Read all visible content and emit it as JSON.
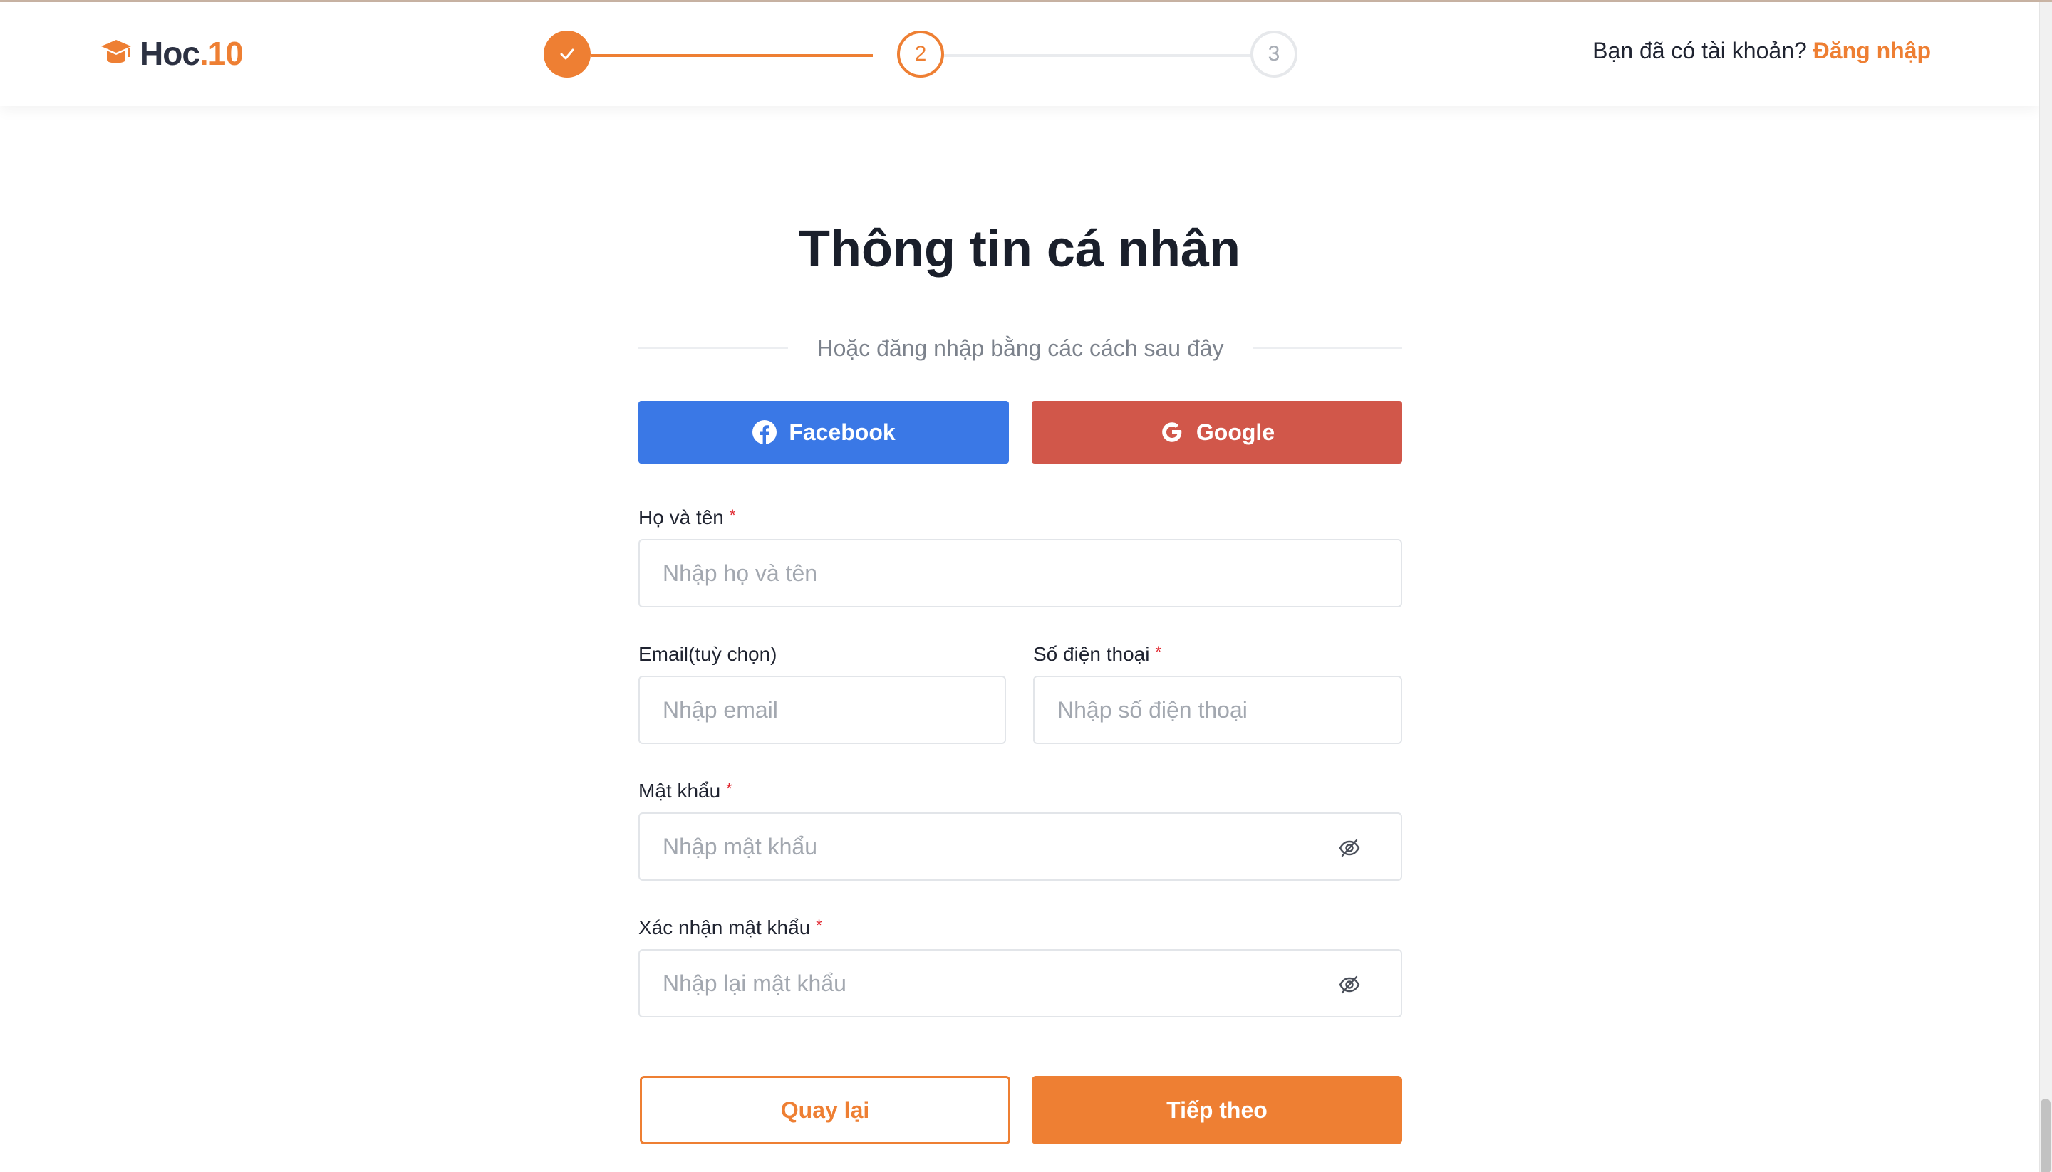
{
  "header": {
    "logo": {
      "main": "Hoc",
      "accent": ".10"
    },
    "steps": [
      {
        "label": "",
        "state": "done",
        "icon": "check-icon"
      },
      {
        "label": "2",
        "state": "active"
      },
      {
        "label": "3",
        "state": "todo"
      }
    ],
    "login_prompt": "Bạn đã có tài khoản?",
    "login_link": "Đăng nhập"
  },
  "form": {
    "title": "Thông tin cá nhân",
    "divider_text": "Hoặc đăng nhập bằng các cách sau đây",
    "social": {
      "facebook_label": "Facebook",
      "facebook_icon": "facebook-icon",
      "google_label": "Google",
      "google_icon": "google-icon"
    },
    "fullname": {
      "label": "Họ và tên",
      "required_mark": "*",
      "placeholder": "Nhập họ và tên"
    },
    "email": {
      "label": "Email(tuỳ chọn)",
      "placeholder": "Nhập email"
    },
    "phone": {
      "label": "Số điện thoại",
      "required_mark": "*",
      "placeholder": "Nhập số điện thoại"
    },
    "password": {
      "label": "Mật khẩu",
      "required_mark": "*",
      "placeholder": "Nhập mật khẩu",
      "icon": "eye-off-icon"
    },
    "confirm_password": {
      "label": "Xác nhận mật khẩu",
      "required_mark": "*",
      "placeholder": "Nhập lại mật khẩu",
      "icon": "eye-off-icon"
    },
    "back_label": "Quay lại",
    "next_label": "Tiếp theo"
  },
  "colors": {
    "accent": "#ee7f33",
    "facebook": "#3a78e6",
    "google": "#d1574a",
    "required": "#e0242c"
  }
}
